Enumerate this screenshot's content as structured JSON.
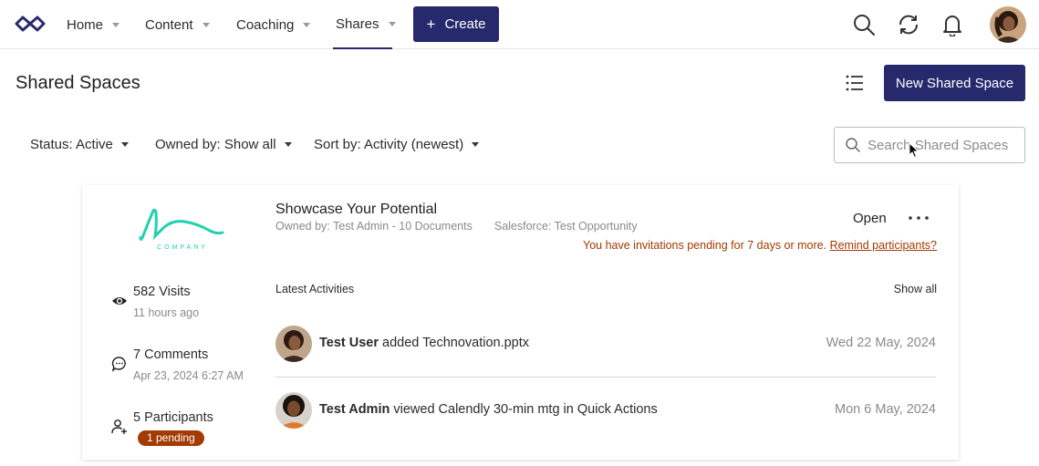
{
  "nav": {
    "items": [
      {
        "label": "Home"
      },
      {
        "label": "Content"
      },
      {
        "label": "Coaching"
      },
      {
        "label": "Shares"
      }
    ],
    "active_item": "Shares",
    "create_label": "Create",
    "create_plus": "+",
    "icons": [
      "logo-icon",
      "search-icon",
      "sync-icon",
      "bell-icon",
      "user-avatar"
    ]
  },
  "header": {
    "title": "Shared Spaces",
    "new_button": "New Shared Space"
  },
  "filters": {
    "status": "Status: Active",
    "owned_by": "Owned by: Show all",
    "sort_by": "Sort by: Activity (newest)",
    "search_placeholder": "Search Shared Spaces"
  },
  "card": {
    "logo_text": "COMPANY",
    "title": "Showcase Your Potential",
    "owner": "Owned by: Test Admin - 10 Documents",
    "salesforce": "Salesforce: Test Opportunity",
    "open_label": "Open",
    "pending_warning": "You have invitations pending for 7 days or more.",
    "remind_link": "Remind participants?",
    "stats": {
      "visits": "582 Visits",
      "visits_sub": "11 hours ago",
      "comments": "7 Comments",
      "comments_sub": "Apr 23, 2024 6:27 AM",
      "participants": "5 Participants",
      "pending_badge": "1 pending"
    },
    "latest_label": "Latest Activities",
    "show_all": "Show all",
    "activities": [
      {
        "user": "Test User",
        "action": " added Technovation.pptx",
        "date": "Wed 22 May, 2024"
      },
      {
        "user": "Test Admin",
        "action": " viewed Calendly 30-min mtg in Quick Actions",
        "date": "Mon 6 May, 2024"
      }
    ]
  },
  "colors": {
    "brand": "#27296d",
    "warning": "#a33a00",
    "logo_accent": "#1fd1b0"
  }
}
